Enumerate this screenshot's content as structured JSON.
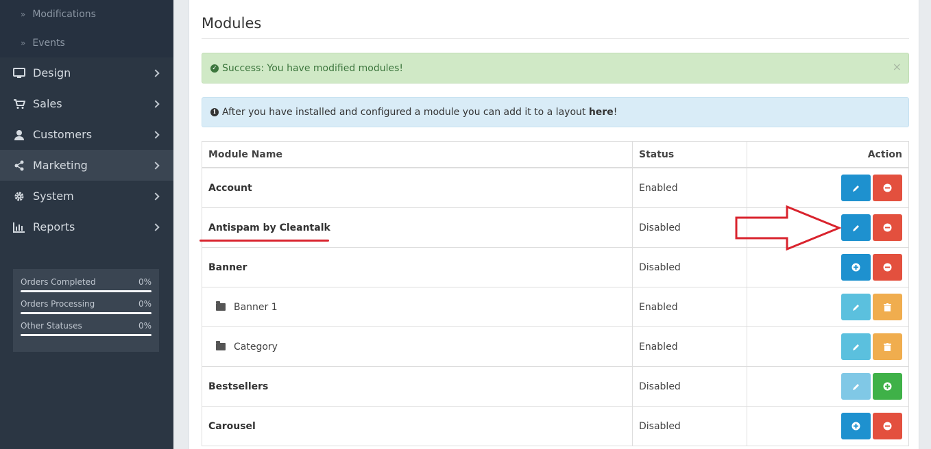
{
  "sidebar": {
    "sub_items": [
      {
        "label": "Modifications"
      },
      {
        "label": "Events"
      }
    ],
    "items": [
      {
        "label": "Design",
        "icon": "monitor-icon"
      },
      {
        "label": "Sales",
        "icon": "cart-icon"
      },
      {
        "label": "Customers",
        "icon": "user-icon"
      },
      {
        "label": "Marketing",
        "icon": "share-icon",
        "active": true
      },
      {
        "label": "System",
        "icon": "gear-icon"
      },
      {
        "label": "Reports",
        "icon": "bar-chart-icon"
      }
    ],
    "stats": [
      {
        "label": "Orders Completed",
        "value": "0%"
      },
      {
        "label": "Orders Processing",
        "value": "0%"
      },
      {
        "label": "Other Statuses",
        "value": "0%"
      }
    ]
  },
  "main": {
    "title": "Modules",
    "success_alert": "Success: You have modified modules!",
    "info_alert_prefix": "After you have installed and configured a module you can add it to a layout ",
    "info_alert_link": "here",
    "info_alert_suffix": "!",
    "close_symbol": "×",
    "table": {
      "headers": [
        "Module Name",
        "Status",
        "Action"
      ],
      "rows": [
        {
          "name": "Account",
          "status": "Enabled"
        },
        {
          "name": "Antispam by Cleantalk",
          "status": "Disabled"
        },
        {
          "name": "Banner",
          "status": "Disabled"
        },
        {
          "name": "Banner 1",
          "status": "Enabled"
        },
        {
          "name": "Category",
          "status": "Enabled"
        },
        {
          "name": "Bestsellers",
          "status": "Disabled"
        },
        {
          "name": "Carousel",
          "status": "Disabled"
        }
      ]
    }
  },
  "colors": {
    "sidebar_bg": "#2b3643",
    "primary": "#1e91cf",
    "danger": "#e3503e",
    "warning": "#f0ad4e",
    "success": "#3fb148",
    "info": "#5bc0de",
    "annotation": "#d9232d"
  }
}
